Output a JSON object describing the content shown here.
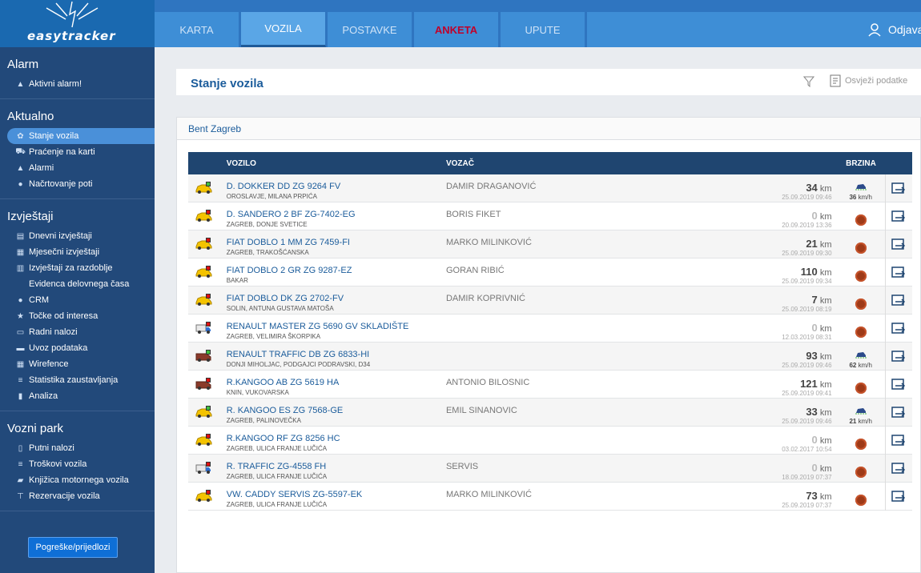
{
  "logo": {
    "text": "easytracker"
  },
  "nav_tabs": [
    {
      "label": "KARTA"
    },
    {
      "label": "VOZILA"
    },
    {
      "label": "POSTAVKE"
    },
    {
      "label": "ANKETA"
    },
    {
      "label": "UPUTE"
    }
  ],
  "logout_label": "Odjava",
  "sidebar": {
    "sections": [
      {
        "title": "Alarm",
        "items": [
          {
            "label": "Aktivni alarm!",
            "icon": "warning-icon"
          }
        ]
      },
      {
        "title": "Aktualno",
        "items": [
          {
            "label": "Stanje vozila",
            "icon": "gear-icon",
            "selected": true
          },
          {
            "label": "Praćenje na karti",
            "icon": "road-icon"
          },
          {
            "label": "Alarmi",
            "icon": "warning-icon"
          },
          {
            "label": "Načrtovanje poti",
            "icon": "pin-icon"
          }
        ]
      },
      {
        "title": "Izvještaji",
        "items": [
          {
            "label": "Dnevni izvještaji",
            "icon": "copy-icon"
          },
          {
            "label": "Mjesečni izvještaji",
            "icon": "calendar-icon"
          },
          {
            "label": "Izvještaji za razdoblje",
            "icon": "clipboard-icon"
          },
          {
            "label": "Evidenca delovnega časa",
            "icon": ""
          },
          {
            "label": "CRM",
            "icon": "user-icon"
          },
          {
            "label": "Točke od interesa",
            "icon": "star-icon"
          },
          {
            "label": "Radni nalozi",
            "icon": "inbox-icon"
          },
          {
            "label": "Uvoz podataka",
            "icon": "tray-icon"
          },
          {
            "label": "Wirefence",
            "icon": "grid-icon"
          },
          {
            "label": "Statistika zaustavljanja",
            "icon": "list-icon"
          },
          {
            "label": "Analiza",
            "icon": "chart-icon"
          }
        ]
      },
      {
        "title": "Vozni park",
        "items": [
          {
            "label": "Putni nalozi",
            "icon": "document-icon"
          },
          {
            "label": "Troškovi vozila",
            "icon": "list-icon"
          },
          {
            "label": "Knjižica motornega vozila",
            "icon": "folder-icon"
          },
          {
            "label": "Rezervacije vozila",
            "icon": "pushpin-icon"
          }
        ]
      }
    ],
    "report_button": "Pogreške/prijedlozi"
  },
  "page": {
    "title": "Stanje vozila",
    "refresh_label": "Osvježi podatke"
  },
  "panel": {
    "title": "Bent Zagreb"
  },
  "table": {
    "headers": {
      "vehicle": "VOZILO",
      "driver": "VOZAČ",
      "speed": "BRZINA"
    },
    "rows": [
      {
        "type": "car",
        "status": "green",
        "vehicle": "D. DOKKER DD ZG 9264 FV",
        "location": "OROSLAVJE, MILANA PRPIĆA",
        "driver": "DAMIR DRAGANOVIĆ",
        "km": "34",
        "unit": "km",
        "date": "25.09.2019 09:46",
        "moving": true,
        "speed": "36",
        "speed_unit": "km/h"
      },
      {
        "type": "car",
        "status": "red",
        "vehicle": "D. SANDERO 2 BF ZG-7402-EG",
        "location": "ZAGREB, DONJE SVETICE",
        "driver": "BORIS FIKET",
        "km": "0",
        "unit": "km",
        "date": "20.09.2019 13:36",
        "moving": false
      },
      {
        "type": "car",
        "status": "red",
        "vehicle": "FIAT DOBLO 1 MM ZG 7459-FI",
        "location": "ZAGREB, TRAKOŠĆANSKA",
        "driver": "MARKO MILINKOVIĆ",
        "km": "21",
        "unit": "km",
        "date": "25.09.2019 09:30",
        "moving": false
      },
      {
        "type": "car",
        "status": "red",
        "vehicle": "FIAT DOBLO 2 GR ZG 9287-EZ",
        "location": "BAKAR",
        "driver": "GORAN RIBIĆ",
        "km": "110",
        "unit": "km",
        "date": "25.09.2019 09:34",
        "moving": false
      },
      {
        "type": "car",
        "status": "red",
        "vehicle": "FIAT DOBLO DK ZG 2702-FV",
        "location": "SOLIN, ANTUNA GUSTAVA MATOŠA",
        "driver": "DAMIR KOPRIVNIĆ",
        "km": "7",
        "unit": "km",
        "date": "25.09.2019 08:19",
        "moving": false
      },
      {
        "type": "truck",
        "status": "red",
        "vehicle": "RENAULT MASTER ZG 5690 GV SKLADIŠTE",
        "location": "ZAGREB, VELIMIRA ŠKORPIKA",
        "driver": "",
        "km": "0",
        "unit": "km",
        "date": "12.03.2019 08:31",
        "moving": false
      },
      {
        "type": "van",
        "status": "green",
        "vehicle": "RENAULT TRAFFIC DB ZG 6833-HI",
        "location": "DONJI MIHOLJAC, PODGAJCI PODRAVSKI, D34",
        "driver": "",
        "km": "93",
        "unit": "km",
        "date": "25.09.2019 09:46",
        "moving": true,
        "speed": "62",
        "speed_unit": "km/h"
      },
      {
        "type": "van",
        "status": "red",
        "vehicle": "R.KANGOO AB ZG 5619 HA",
        "location": "KNIN, VUKOVARSKA",
        "driver": "ANTONIO BILOSNIC",
        "km": "121",
        "unit": "km",
        "date": "25.09.2019 09:41",
        "moving": false
      },
      {
        "type": "car",
        "status": "green",
        "vehicle": "R. KANGOO ES ZG 7568-GE",
        "location": "ZAGREB, PALINOVEČKA",
        "driver": "EMIL SINANOVIC",
        "km": "33",
        "unit": "km",
        "date": "25.09.2019 09:46",
        "moving": true,
        "speed": "21",
        "speed_unit": "km/h"
      },
      {
        "type": "car",
        "status": "red",
        "vehicle": "R.KANGOO RF ZG 8256 HC",
        "location": "ZAGREB, ULICA FRANJE LUČIĆA",
        "driver": "",
        "km": "0",
        "unit": "km",
        "date": "03.02.2017 10:54",
        "moving": false
      },
      {
        "type": "truck",
        "status": "red",
        "vehicle": "R. TRAFFIC ZG-4558 FH",
        "location": "ZAGREB, ULICA FRANJE LUČIĆA",
        "driver": "SERVIS",
        "km": "0",
        "unit": "km",
        "date": "18.09.2019 07:37",
        "moving": false
      },
      {
        "type": "car",
        "status": "red",
        "vehicle": "VW. CADDY SERVIS ZG-5597-EK",
        "location": "ZAGREB, ULICA FRANJE LUČIĆA",
        "driver": "MARKO MILINKOVIĆ",
        "km": "73",
        "unit": "km",
        "date": "25.09.2019 07:37",
        "moving": false
      }
    ]
  },
  "colors": {
    "sidebar": "#22497a",
    "topbar": "#2f75c0",
    "tab": "#3e8ed6",
    "active_tab": "#5aa6e6",
    "anketa": "#c0002a",
    "header_row": "#1f4570",
    "status_green": "#3fbf3f",
    "status_red": "#e01010",
    "link": "#1b5c9b"
  }
}
